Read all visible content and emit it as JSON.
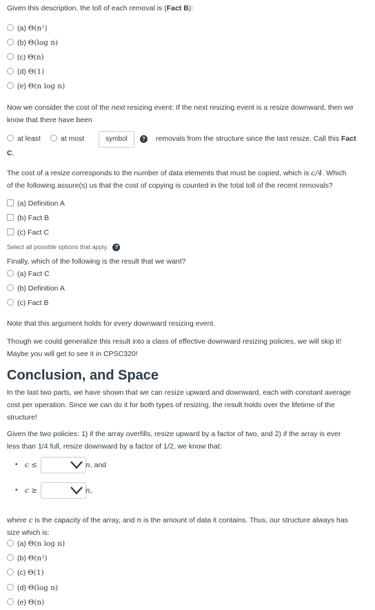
{
  "q1": {
    "intro_pre": "Given this description, the toll of each removal is (",
    "intro_bold": "Fact B",
    "intro_post": "):",
    "options": [
      {
        "label": "(a)",
        "math": "Θ(n²)"
      },
      {
        "label": "(b)",
        "math": "Θ(log n)"
      },
      {
        "label": "(c)",
        "math": "Θ(n)"
      },
      {
        "label": "(d)",
        "math": "Θ(1)"
      },
      {
        "label": "(e)",
        "math": "Θ(n log n)"
      }
    ]
  },
  "q2": {
    "para_pre": "Now we consider the cost of the ",
    "para_em": "next",
    "para_post": " resizing event: If the next resizing event is a resize downward, then we",
    "para_line2": "know that there have been",
    "radio1": "at least",
    "radio2": "at most",
    "symbol": "symbol",
    "after_symbol": "removals from the structure since the last resize. Call this ",
    "fact_bold": "Fact",
    "fact_c": "C",
    "fact_c_tail": "."
  },
  "q3": {
    "line1_pre": "The cost of a resize corresponds to the number of data elements that must be copied, which is ",
    "line1_math": "c/4",
    "line1_post": ". Which",
    "line2": "of the following assure(s) us that the cost of copying is counted in the total toll of the recent removals?",
    "options": [
      {
        "label": "(a) Definition A"
      },
      {
        "label": "(b) Fact B"
      },
      {
        "label": "(c) Fact C"
      }
    ],
    "hint": "Select all possible options that apply."
  },
  "q4": {
    "prompt": "Finally, which of the following is the result that we want?",
    "options": [
      {
        "label": "(a) Fact C"
      },
      {
        "label": "(b) Definition A"
      },
      {
        "label": "(c) Fact B"
      }
    ]
  },
  "note": {
    "pre": "Note that this argument holds for ",
    "em": "every",
    "post": " downward resizing event."
  },
  "generalize": {
    "line1": "Though we could generalize this result into a class of effective downward resizing policies, we will skip it!",
    "line2": "Maybe you will get to see it in CPSC320!"
  },
  "conclusion": {
    "heading": "Conclusion, and Space",
    "para1_l1": "In the last two parts, we have shown that we can resize upward and downward, each with constant average",
    "para1_l2": "cost per operation. Since we can do it for both types of resizing, the result holds over the lifetime of the",
    "para1_l3": "structure!",
    "para2_l1": "Given the two policies: 1) if the array overfills, resize upward by a factor of two, and 2) if the array is ever",
    "para2_l2": "less than 1/4 full, resize downward by a factor of 1/2, we know that:",
    "bullet1_math": "c ≤",
    "bullet1_after": "n",
    "bullet1_tail": ", and",
    "bullet2_math": "c ≥",
    "bullet2_after": "n",
    "bullet2_tail": ","
  },
  "q5": {
    "line1_pre": "where ",
    "line1_c": "c",
    "line1_mid": " is the capacity of the array, and ",
    "line1_n": "n",
    "line1_post": " is the amount of data it contains. Thus, our structure always has",
    "line2": "size which is:",
    "options": [
      {
        "label": "(a)",
        "math": "Θ(n log n)"
      },
      {
        "label": "(b)",
        "math": "Θ(n²)"
      },
      {
        "label": "(c)",
        "math": "Θ(1)"
      },
      {
        "label": "(d)",
        "math": "Θ(log n)"
      },
      {
        "label": "(e)",
        "math": "Θ(n)"
      }
    ]
  }
}
